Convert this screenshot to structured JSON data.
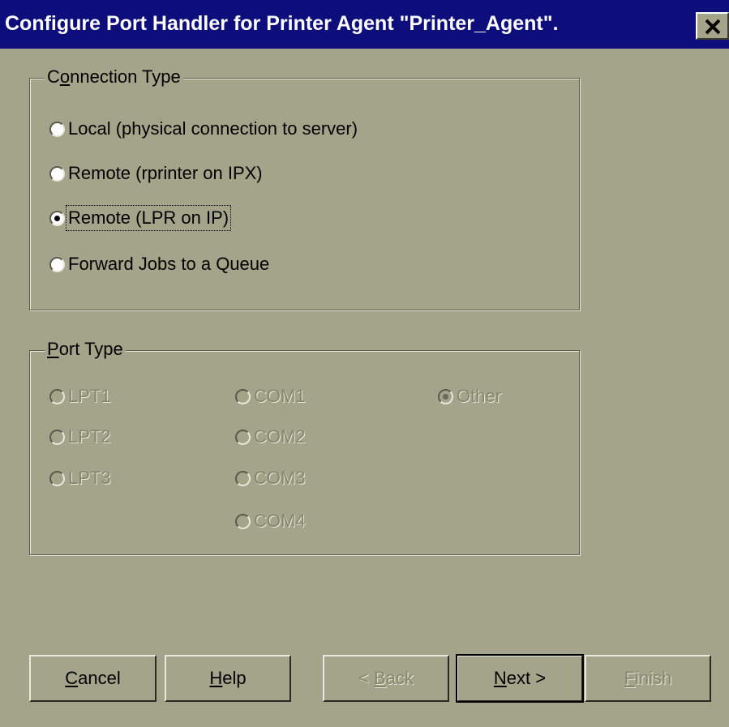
{
  "window": {
    "title": "Configure Port Handler for Printer Agent \"Printer_Agent\".",
    "close_icon": "close-x-icon"
  },
  "connection_type": {
    "legend_pre": "C",
    "legend_key": "o",
    "legend_post": "nnection Type",
    "options": [
      {
        "label": "Local (physical connection to server)",
        "checked": false
      },
      {
        "label": "Remote (rprinter on IPX)",
        "checked": false
      },
      {
        "label": "Remote (LPR on IP)",
        "checked": true
      },
      {
        "label": "Forward Jobs to a Queue",
        "checked": false
      }
    ]
  },
  "port_type": {
    "legend_key": "P",
    "legend_post": "ort Type",
    "enabled": false,
    "options": [
      {
        "label": "LPT1",
        "checked": false
      },
      {
        "label": "LPT2",
        "checked": false
      },
      {
        "label": "LPT3",
        "checked": false
      },
      {
        "label": "COM1",
        "checked": false
      },
      {
        "label": "COM2",
        "checked": false
      },
      {
        "label": "COM3",
        "checked": false
      },
      {
        "label": "COM4",
        "checked": false
      },
      {
        "label": "Other",
        "checked": true
      }
    ]
  },
  "buttons": {
    "cancel": {
      "key": "C",
      "rest": "ancel"
    },
    "help": {
      "key": "H",
      "rest": "elp"
    },
    "back": {
      "pre": "< ",
      "key": "B",
      "rest": "ack"
    },
    "next": {
      "key": "N",
      "rest": "ext >"
    },
    "finish": {
      "key": "F",
      "rest": "inish"
    }
  }
}
